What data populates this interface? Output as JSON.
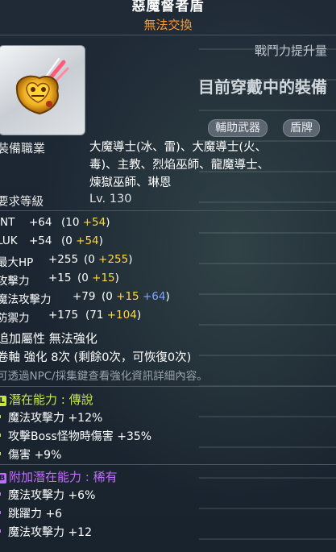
{
  "item": {
    "name": "惡魔督者盾",
    "trade": "無法交換"
  },
  "power_label": "戰鬥力提升量",
  "equipped_label": "目前穿戴中的裝備",
  "badges": [
    "輔助武器",
    "盾牌"
  ],
  "job_label": "裝備職業",
  "jobs": [
    "大魔導士(冰、雷)、大魔導士(火、",
    "毒)、主教、烈焰巫師、龍魔導士、",
    "煉獄巫師、琳恩"
  ],
  "level_label": "要求等級",
  "level_value": "Lv. 130",
  "stats": [
    {
      "name": "INT",
      "total": "+64",
      "open": "(10 ",
      "add": "+54",
      "close": ")"
    },
    {
      "name": "LUK",
      "total": "+54",
      "open": "(0 ",
      "add": "+54",
      "close": ")"
    },
    {
      "name": "最大HP",
      "total": "+255",
      "open": "(0 ",
      "add": "+255",
      "close": ")"
    },
    {
      "name": "攻擊力",
      "total": "+15",
      "open": "(0 ",
      "add": "+15",
      "close": ")"
    },
    {
      "name": "魔法攻擊力",
      "total": "+79",
      "open": "(0 ",
      "add": "+15",
      "extra": "+64",
      "close": ")"
    },
    {
      "name": "防禦力",
      "total": "+175",
      "open": "(71 ",
      "add": "+104",
      "close": ")"
    }
  ],
  "extra_attr": "追加屬性 無法強化",
  "enhance": "卷軸 強化 8次 (剩餘0次，可恢復0次)",
  "npc_info": "可透過NPC/採集鍵查看強化資訊詳細內容。",
  "potential": {
    "head": "潛在能力 : 傳說",
    "icon": "L",
    "color": "#c8e64a",
    "lines": [
      {
        "name": "魔法攻擊力",
        "value": "+12%"
      },
      {
        "name": "攻擊Boss怪物時傷害",
        "value": "+35%"
      },
      {
        "name": "傷害",
        "value": "+9%"
      }
    ]
  },
  "bonus_potential": {
    "head": "附加潛在能力 : 稀有",
    "icon": "B",
    "color": "#c06cff",
    "lines": [
      {
        "name": "魔法攻擊力",
        "value": "+6%"
      },
      {
        "name": "跳躍力",
        "value": "+6"
      },
      {
        "name": "魔法攻擊力",
        "value": "+12"
      }
    ]
  },
  "colors": {
    "trade": "#ff9a2e",
    "bonus_yellow": "#ffd93a",
    "bonus_blue": "#7ba7ff",
    "legendary": "#c8e64a",
    "rare": "#c06cff"
  },
  "icons": {
    "item": "shield-icon"
  }
}
